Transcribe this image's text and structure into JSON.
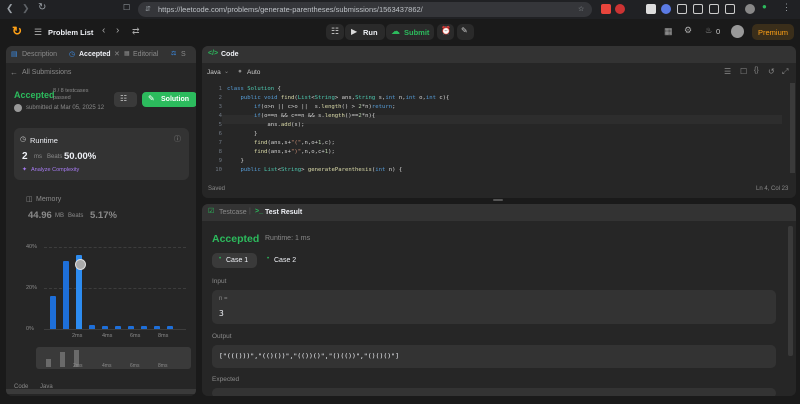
{
  "browser": {
    "url": "https://leetcode.com/problems/generate-parentheses/submissions/1563437862/"
  },
  "header": {
    "problem_list": "Problem List",
    "run": "Run",
    "submit": "Submit",
    "streak": "0",
    "premium": "Premium"
  },
  "left_tabs": {
    "description": "Description",
    "accepted": "Accepted",
    "editorial": "Editorial",
    "solutions": "S"
  },
  "submission": {
    "back": "All Submissions",
    "status": "Accepted",
    "testcases": "8 / 8 testcases",
    "passed": "passed",
    "submitted_at": "submitted at Mar 05, 2025 12",
    "solution_btn": "Solution"
  },
  "runtime": {
    "label": "Runtime",
    "value": "2",
    "unit": "ms",
    "beats_label": "Beats",
    "beats": "50.00%",
    "analyze": "Analyze Complexity"
  },
  "memory": {
    "label": "Memory",
    "value": "44.96",
    "unit": "MB",
    "beats_label": "Beats",
    "beats": "5.17%"
  },
  "chart": {
    "y_ticks": [
      "40%",
      "20%",
      "0%"
    ],
    "x_ticks": [
      "2ms",
      "4ms",
      "6ms",
      "8ms"
    ],
    "mini_ticks": [
      "2ms",
      "4ms",
      "6ms",
      "8ms"
    ]
  },
  "chart_data": {
    "type": "bar",
    "x": [
      "0ms",
      "1ms",
      "2ms",
      "3ms",
      "4ms",
      "5ms",
      "6ms",
      "7ms",
      "8ms",
      "9ms"
    ],
    "values": [
      16,
      33,
      36,
      2,
      1.5,
      1.5,
      1.5,
      1.5,
      1.5,
      1.5
    ],
    "highlight_index": 2,
    "ylim": [
      0,
      40
    ],
    "grid": true
  },
  "left_footer": {
    "code_label": "Code",
    "lang": "Java"
  },
  "code_panel": {
    "title": "Code",
    "language": "Java",
    "mode": "Auto",
    "saved": "Saved",
    "cursor": "Ln 4, Col 23",
    "line_numbers": [
      "1",
      "2",
      "3",
      "4",
      "5",
      "6",
      "7",
      "8",
      "9",
      "10"
    ]
  },
  "test_panel": {
    "testcase_tab": "Testcase",
    "result_tab": "Test Result",
    "status": "Accepted",
    "runtime": "Runtime: 1 ms",
    "case1": "Case 1",
    "case2": "Case 2",
    "input_label": "Input",
    "input_var": "n =",
    "input_value": "3",
    "output_label": "Output",
    "output_value": "[\"((()))\",\"(()())\",\"(())()\",\"()(())\",\"()()()\"]",
    "expected_label": "Expected"
  },
  "colors": {
    "accent_green": "#2cbb5d",
    "bar_blue": "#1e6fd9",
    "premium": "#ffa116"
  }
}
